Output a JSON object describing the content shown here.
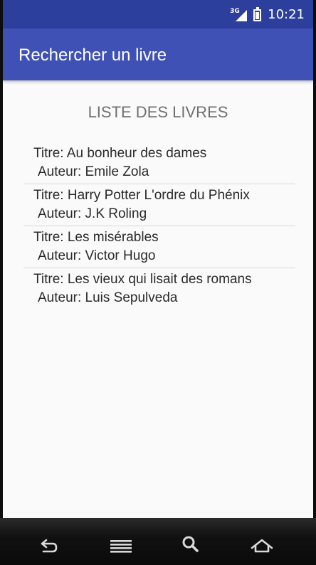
{
  "status_bar": {
    "network": "3G",
    "time": "10:21",
    "signal_icon": "cell-signal-icon",
    "battery_icon": "battery-icon"
  },
  "app_bar": {
    "title": "Rechercher un livre"
  },
  "list": {
    "heading": "LISTE DES LIVRES",
    "items": [
      {
        "title": "Titre: Au bonheur des dames",
        "author": "Auteur: Emile Zola"
      },
      {
        "title": "Titre: Harry Potter L'ordre du Phénix",
        "author": "Auteur: J.K Roling"
      },
      {
        "title": "Titre: Les misérables",
        "author": "Auteur: Victor Hugo"
      },
      {
        "title": "Titre: Les vieux qui lisait des romans",
        "author": "Auteur: Luis Sepulveda"
      }
    ]
  },
  "nav_bar": {
    "icons": [
      "back-icon",
      "menu-icon",
      "search-icon",
      "home-icon"
    ]
  },
  "colors": {
    "status_bar": "#2d3f9c",
    "app_bar": "#3f51b5",
    "background": "#fafafa",
    "heading_text": "#707070",
    "divider": "#d8d8d8"
  }
}
